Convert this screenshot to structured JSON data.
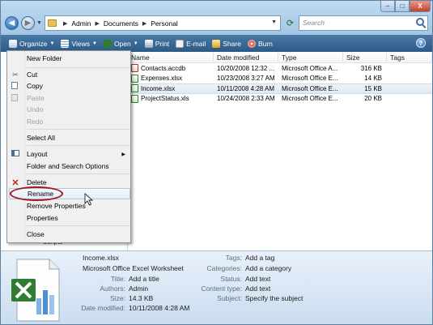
{
  "address": {
    "crumbs": [
      "Admin",
      "Documents",
      "Personal"
    ],
    "search_placeholder": "Search"
  },
  "window_controls": {
    "minimize": "–",
    "maximize": "□",
    "close": "X"
  },
  "toolbar": {
    "organize": "Organize",
    "views": "Views",
    "open": "Open",
    "print": "Print",
    "email": "E-mail",
    "share": "Share",
    "burn": "Burn",
    "help": "?"
  },
  "columns": {
    "name": "Name",
    "date": "Date modified",
    "type": "Type",
    "size": "Size",
    "tags": "Tags"
  },
  "files": [
    {
      "name": "Contacts.accdb",
      "date": "10/20/2008 12:32 ...",
      "type": "Microsoft Office A...",
      "size": "316 KB",
      "kind": "access"
    },
    {
      "name": "Expenses.xlsx",
      "date": "10/23/2008 3:27 AM",
      "type": "Microsoft Office E...",
      "size": "14 KB",
      "kind": "excel"
    },
    {
      "name": "Income.xlsx",
      "date": "10/11/2008 4:28 AM",
      "type": "Microsoft Office E...",
      "size": "15 KB",
      "kind": "excel"
    },
    {
      "name": "ProjectStatus.xls",
      "date": "10/24/2008 2:33 AM",
      "type": "Microsoft Office E...",
      "size": "20 KB",
      "kind": "excel"
    }
  ],
  "menu": {
    "new_folder": "New Folder",
    "cut": "Cut",
    "copy": "Copy",
    "paste": "Paste",
    "undo": "Undo",
    "redo": "Redo",
    "select_all": "Select All",
    "layout": "Layout",
    "folder_options": "Folder and Search Options",
    "delete": "Delete",
    "rename": "Rename",
    "remove_properties": "Remove Properties",
    "properties": "Properties",
    "close": "Close"
  },
  "nav": {
    "scripts": "Scripts"
  },
  "details": {
    "filename": "Income.xlsx",
    "filetype": "Microsoft Office Excel Worksheet",
    "title_label": "Title:",
    "title_value": "Add a title",
    "authors_label": "Authors:",
    "authors_value": "Admin",
    "size_label": "Size:",
    "size_value": "14.3 KB",
    "date_label": "Date modified:",
    "date_value": "10/11/2008 4:28 AM",
    "tags_label": "Tags:",
    "tags_value": "Add a tag",
    "categories_label": "Categories:",
    "categories_value": "Add a category",
    "status_label": "Status:",
    "status_value": "Add text",
    "content_label": "Content type:",
    "content_value": "Add text",
    "subject_label": "Subject:",
    "subject_value": "Specify the subject"
  },
  "colors": {
    "toolbar": "#2c5a86",
    "highlight_circle": "#a31a1a",
    "excel_green": "#2f7d32"
  }
}
